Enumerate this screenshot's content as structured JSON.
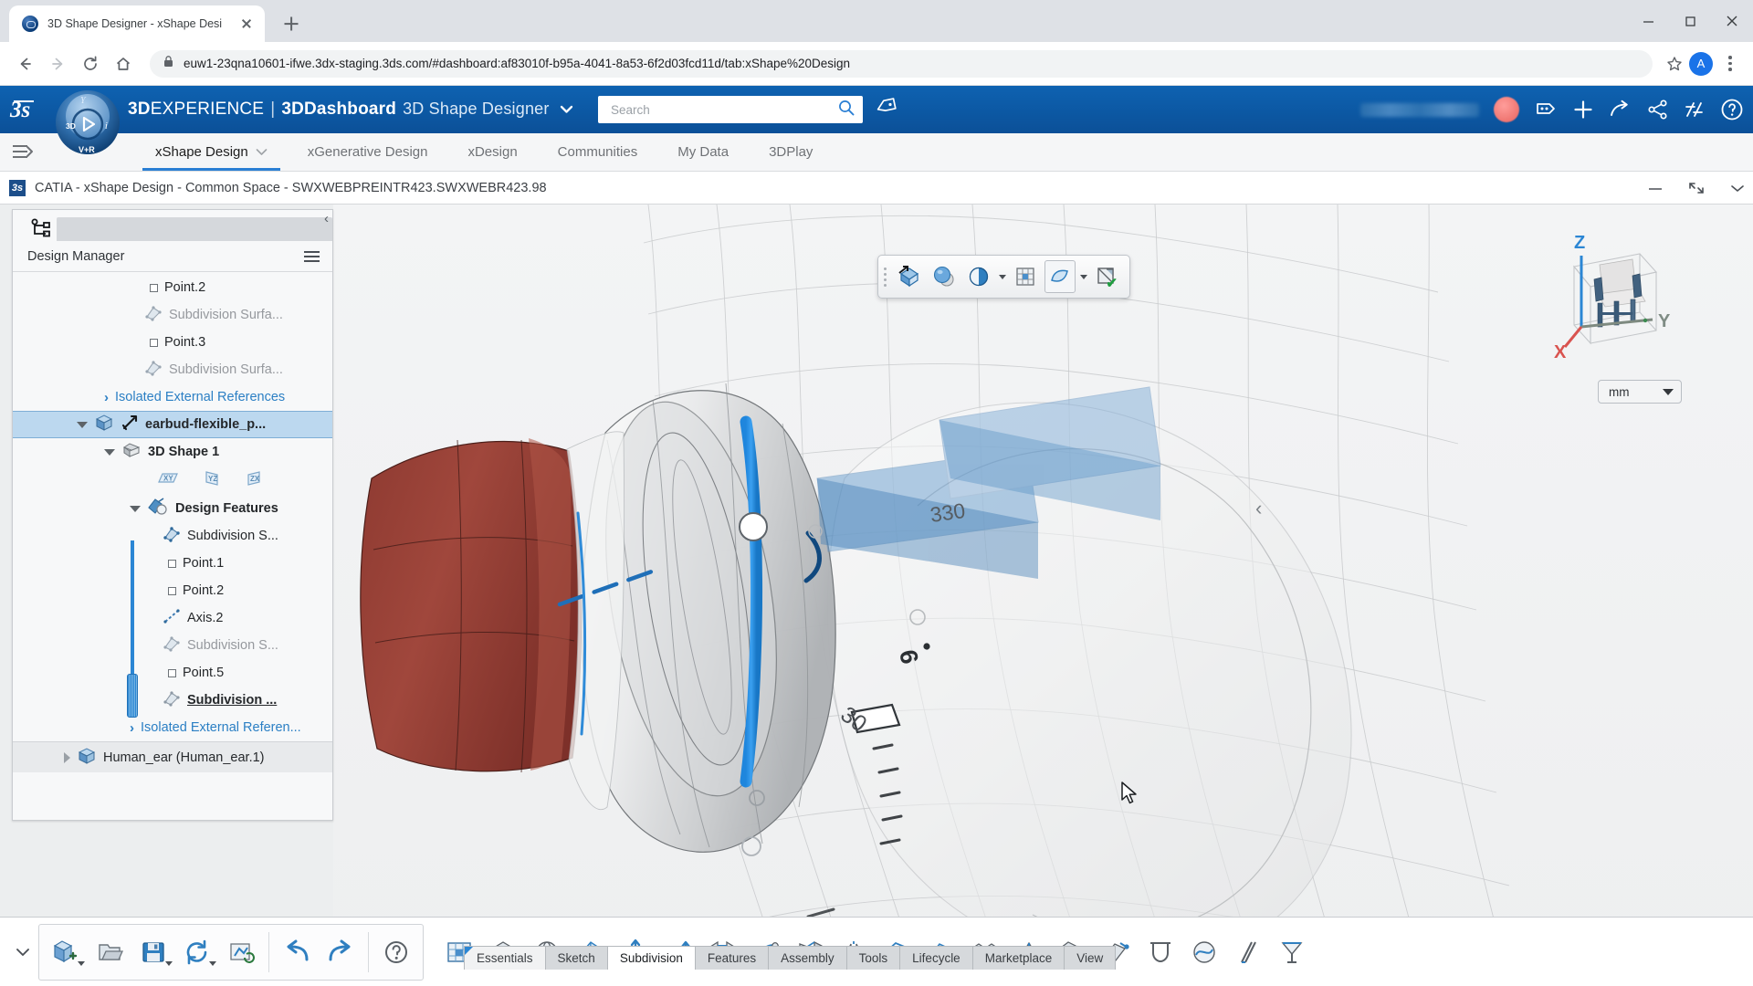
{
  "browser": {
    "tab_title": "3D Shape Designer - xShape Desi",
    "url": "euw1-23qna10601-ifwe.3dx-staging.3ds.com/#dashboard:af83010f-b95a-4041-8a53-6f2d03fcd11d/tab:xShape%20Design",
    "profile_initial": "A",
    "icons": {
      "back": "back-arrow-icon",
      "forward": "forward-arrow-icon",
      "reload": "reload-icon",
      "home": "home-icon",
      "lock": "lock-icon",
      "bookmark": "star-icon",
      "menu": "kebab-menu-icon",
      "new_tab": "plus-icon",
      "close_tab": "close-icon",
      "minimize": "minimize-icon",
      "maximize": "maximize-icon",
      "window_close": "window-close-icon"
    }
  },
  "dx_header": {
    "brand_bold": "3D",
    "brand_rest": "EXPERIENCE",
    "separator": "|",
    "dashboard": "3DDashboard",
    "app_name": "3D Shape Designer",
    "search_placeholder": "Search",
    "search_value": "",
    "accent_color": "#0b5098",
    "icons": [
      "tag-icon",
      "notification-icon",
      "plus-icon",
      "share-arrow-icon",
      "share-nodes-icon",
      "collaboration-icon",
      "help-icon"
    ]
  },
  "app_tabs": [
    {
      "label": "xShape Design",
      "active": true,
      "has_chevron": true
    },
    {
      "label": "xGenerative Design",
      "active": false,
      "has_chevron": false
    },
    {
      "label": "xDesign",
      "active": false,
      "has_chevron": false
    },
    {
      "label": "Communities",
      "active": false,
      "has_chevron": false
    },
    {
      "label": "My Data",
      "active": false,
      "has_chevron": false
    },
    {
      "label": "3DPlay",
      "active": false,
      "has_chevron": false
    }
  ],
  "catia_bar": {
    "title": "CATIA - xShape Design - Common Space - SWXWEBPREINTR423.SWXWEBR423.98",
    "logo": "ds-logo-icon",
    "controls": [
      "minimize-icon",
      "restore-icon",
      "chevron-down-icon"
    ]
  },
  "design_manager": {
    "panel_title": "Design Manager",
    "tab_icon": "tree-structure-icon",
    "menu_icon": "hamburger-menu-icon",
    "collapse_icon": "chevron-left-icon",
    "tree": [
      {
        "label": "Point.2",
        "indent": 150,
        "icon": "point-icon",
        "style": "normal",
        "twisty": "none"
      },
      {
        "label": "Subdivision Surfa...",
        "indent": 150,
        "icon": "subdivision-icon",
        "style": "muted",
        "twisty": "none"
      },
      {
        "label": "Point.3",
        "indent": 150,
        "icon": "point-icon",
        "style": "normal",
        "twisty": "none"
      },
      {
        "label": "Subdivision Surfa...",
        "indent": 150,
        "icon": "subdivision-icon",
        "style": "muted",
        "twisty": "none"
      },
      {
        "label": "Isolated External References",
        "indent": 100,
        "icon": "none",
        "style": "link",
        "twisty": "chev-right"
      },
      {
        "label": "earbud-flexible_p...",
        "indent": 70,
        "icon": "product-icon",
        "style": "selected",
        "twisty": "down"
      },
      {
        "label": "3D Shape 1",
        "indent": 100,
        "icon": "shape-icon",
        "style": "bold",
        "twisty": "down"
      },
      {
        "label": "Design Features",
        "indent": 128,
        "icon": "features-icon",
        "style": "bold",
        "twisty": "down"
      },
      {
        "label": "Subdivision S...",
        "indent": 170,
        "icon": "subdivision-icon",
        "style": "normal",
        "twisty": "none"
      },
      {
        "label": "Point.1",
        "indent": 170,
        "icon": "point-icon",
        "style": "normal",
        "twisty": "none"
      },
      {
        "label": "Point.2",
        "indent": 170,
        "icon": "point-icon",
        "style": "normal",
        "twisty": "none"
      },
      {
        "label": "Axis.2",
        "indent": 170,
        "icon": "axis-icon",
        "style": "normal",
        "twisty": "none"
      },
      {
        "label": "Subdivision S...",
        "indent": 170,
        "icon": "subdivision-icon",
        "style": "muted",
        "twisty": "none"
      },
      {
        "label": "Point.5",
        "indent": 170,
        "icon": "point-icon",
        "style": "normal",
        "twisty": "none"
      },
      {
        "label": "Subdivision ...",
        "indent": 170,
        "icon": "subdivision-icon",
        "style": "underline",
        "twisty": "none"
      },
      {
        "label": "Isolated External Referen...",
        "indent": 128,
        "icon": "none",
        "style": "link",
        "twisty": "chev-right"
      },
      {
        "label": "Human_ear (Human_ear.1)",
        "indent": 60,
        "icon": "product-icon",
        "style": "rowsel",
        "twisty": "right"
      }
    ],
    "planes": [
      "xy-plane-icon",
      "yz-plane-icon",
      "zx-plane-icon"
    ]
  },
  "viewport": {
    "toolbar_buttons": [
      "manipulator-icon",
      "material-sphere-icon",
      "display-mode-icon",
      "snap-grid-icon",
      "shape-mode-icon",
      "exit-app-icon"
    ],
    "confirm_check": "✔",
    "side_collapse": "‹",
    "unit": "mm",
    "unit_caret": "chevron-down-icon",
    "axis_labels": {
      "x": "X",
      "y": "Y",
      "z": "Z"
    },
    "axis_colors": {
      "x": "#d9534f",
      "y": "#6c8b7b",
      "z": "#2b86d4"
    },
    "scene_annotations": [
      "330",
      "30",
      "6"
    ],
    "cursor": "arrow-cursor"
  },
  "bottom_tabs": [
    {
      "label": "Essentials",
      "active": false,
      "first": true
    },
    {
      "label": "Sketch",
      "active": false,
      "first": false
    },
    {
      "label": "Subdivision",
      "active": true,
      "first": false
    },
    {
      "label": "Features",
      "active": false,
      "first": false
    },
    {
      "label": "Assembly",
      "active": false,
      "first": false
    },
    {
      "label": "Tools",
      "active": false,
      "first": false
    },
    {
      "label": "Lifecycle",
      "active": false,
      "first": false
    },
    {
      "label": "Marketplace",
      "active": false,
      "first": false
    },
    {
      "label": "View",
      "active": false,
      "first": false
    }
  ],
  "action_bar": {
    "collapse_icon": "chevron-down-icon",
    "group1": [
      {
        "icon": "new-shape-icon",
        "dropdown": true
      },
      {
        "icon": "open-icon",
        "dropdown": false
      },
      {
        "icon": "save-icon",
        "dropdown": true
      },
      {
        "icon": "refresh-icon",
        "dropdown": true
      },
      {
        "icon": "update-icon",
        "dropdown": false
      },
      {
        "icon": "undo-icon",
        "dropdown": false
      },
      {
        "icon": "redo-icon",
        "dropdown": false
      },
      {
        "icon": "help-circle-icon",
        "dropdown": false
      }
    ],
    "group2": [
      {
        "icon": "grid-surface-icon",
        "dropdown": false
      },
      {
        "icon": "cube-primitive-icon",
        "dropdown": true
      },
      {
        "icon": "sphere-primitive-icon",
        "dropdown": true
      },
      {
        "icon": "subdivide-icon",
        "dropdown": false
      },
      {
        "icon": "extrude-icon",
        "dropdown": false
      },
      {
        "icon": "push-pull-icon",
        "dropdown": false
      },
      {
        "icon": "bridge-icon",
        "dropdown": false
      },
      {
        "icon": "sweep-icon",
        "dropdown": false
      },
      {
        "icon": "loft-icon",
        "dropdown": false
      },
      {
        "icon": "mirror-icon",
        "dropdown": false
      },
      {
        "icon": "thicken-icon",
        "dropdown": false
      },
      {
        "icon": "fill-icon",
        "dropdown": false
      },
      {
        "icon": "pattern-icon",
        "dropdown": false
      },
      {
        "icon": "crease-icon",
        "dropdown": false
      },
      {
        "icon": "delete-face-icon",
        "dropdown": false
      },
      {
        "icon": "tag-face-icon",
        "dropdown": false
      },
      {
        "icon": "weld-icon",
        "dropdown": false
      },
      {
        "icon": "smooth-icon",
        "dropdown": false
      },
      {
        "icon": "slice-icon",
        "dropdown": false
      },
      {
        "icon": "cage-icon",
        "dropdown": false
      }
    ]
  }
}
